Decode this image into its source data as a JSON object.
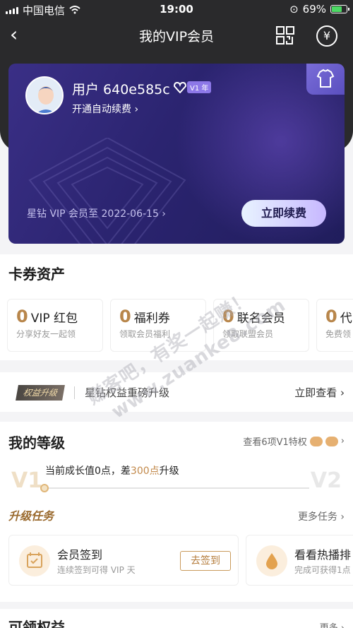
{
  "status": {
    "carrier": "中国电信",
    "time": "19:00",
    "battery": "69%"
  },
  "nav": {
    "back": "‹",
    "title": "我的VIP会员",
    "coin_symbol": "¥"
  },
  "vip_card": {
    "username": "用户 640e585c",
    "level_badge": "V1 年",
    "auto_renew": "开通自动续费 ›",
    "expire": "星钻 VIP 会员至 2022-06-15 ›",
    "renew_button": "立即续费"
  },
  "assets": {
    "title": "卡券资产",
    "cards": [
      {
        "num": "0",
        "name": "VIP 红包",
        "sub": "分享好友一起领"
      },
      {
        "num": "0",
        "name": "福利券",
        "sub": "领取会员福利"
      },
      {
        "num": "0",
        "name": "联名会员",
        "sub": "领取联盟会员"
      },
      {
        "num": "0",
        "name": "代",
        "sub": "免费领"
      }
    ]
  },
  "upgrade_strip": {
    "tag": "权益升级",
    "text": "星钻权益重磅升级",
    "more": "立即查看 ›"
  },
  "level": {
    "title": "我的等级",
    "view_all": "查看6项V1特权",
    "current": "V1",
    "next": "V2",
    "growth_prefix": "当前成长值0点，差",
    "growth_points": "300点",
    "growth_suffix": "升级",
    "task_title": "升级任务",
    "more_tasks": "更多任务 ›",
    "tasks": [
      {
        "title": "会员签到",
        "sub": "连续签到可得 VIP 天",
        "button": "去签到"
      },
      {
        "title": "看看热播排",
        "sub": "完成可获得1点"
      }
    ]
  },
  "bottom": {
    "title": "可领权益",
    "more": "更多 ›"
  },
  "watermark": {
    "line1": "赚客吧，有奖一起赚！",
    "line2": "www.zuanke8.com"
  }
}
